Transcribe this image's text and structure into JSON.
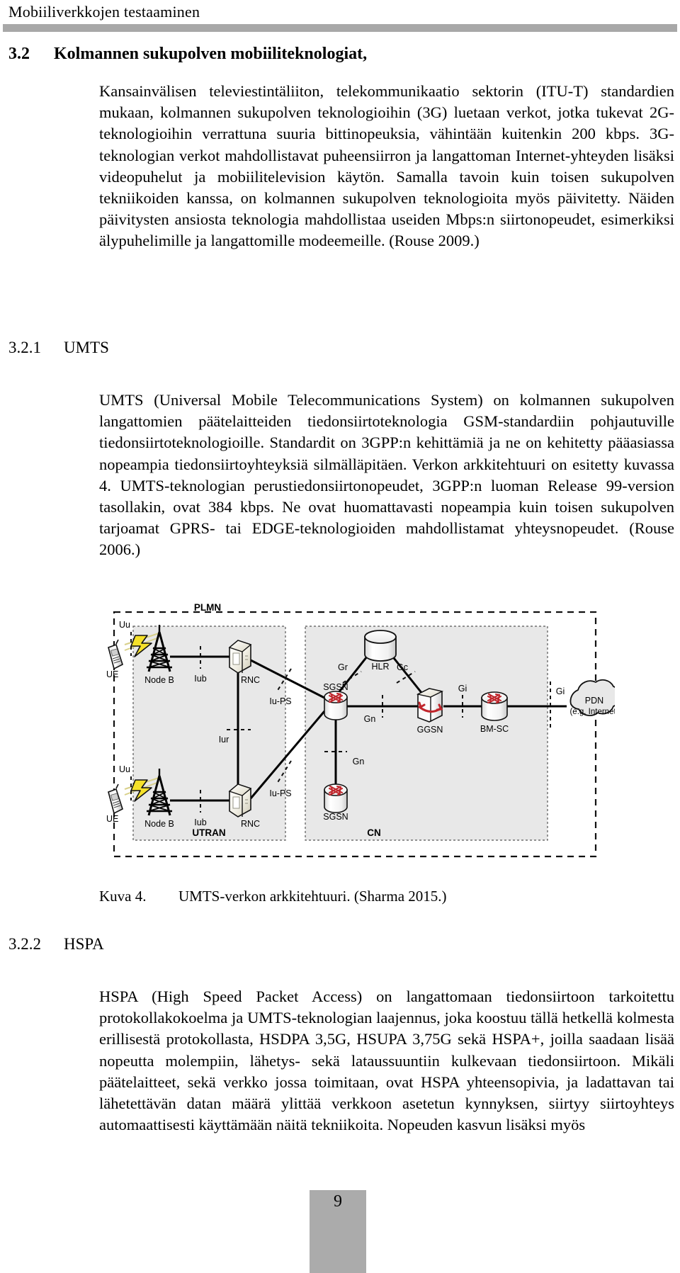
{
  "header": {
    "running_title": "Mobiiliverkkojen testaaminen"
  },
  "sections": [
    {
      "number": "3.2",
      "title": "Kolmannen sukupolven mobiiliteknologiat,",
      "body": "Kansainvälisen televiestintäliiton, telekommunikaatio sektorin (ITU-T) standardien mukaan, kolmannen sukupolven teknologioihin (3G) luetaan verkot, jotka tukevat 2G-teknologioihin verrattuna suuria bittinopeuksia, vähintään kuitenkin 200 kbps. 3G-teknologian verkot mahdollistavat puheensiirron ja langattoman Internet-yhteyden lisäksi videopuhelut ja mobiilitelevision käytön. Samalla tavoin kuin toisen sukupolven tekniikoiden kanssa, on kolmannen sukupolven teknologioita myös päivitetty. Näiden päivitysten ansiosta teknologia mahdollistaa useiden Mbps:n siirtonopeudet, esimerkiksi älypuhelimille ja langattomille modeemeille. (Rouse 2009.)"
    },
    {
      "number": "3.2.1",
      "title": "UMTS",
      "body": "UMTS (Universal Mobile Telecommunications System) on kolmannen sukupolven langattomien päätelaitteiden tiedonsiirtoteknologia GSM-standardiin pohjautuville tiedonsiirtoteknologioille. Standardit on 3GPP:n kehittämiä ja ne on kehitetty pääasiassa nopeampia tiedonsiirtoyhteyksiä silmälläpitäen. Verkon arkkitehtuuri on esitetty kuvassa 4. UMTS-teknologian perustiedonsiirtonopeudet, 3GPP:n luoman Release 99-version tasollakin, ovat 384 kbps. Ne ovat huomattavasti nopeampia kuin toisen sukupolven tarjoamat GPRS- tai EDGE-teknologioiden mahdollistamat yhteysnopeudet. (Rouse 2006.)"
    },
    {
      "number": "3.2.2",
      "title": "HSPA",
      "body": "HSPA (High Speed Packet Access) on langattomaan tiedonsiirtoon tarkoitettu protokollakokoelma ja UMTS-teknologian laajennus, joka koostuu tällä hetkellä kolmesta erillisestä protokollasta, HSDPA 3,5G, HSUPA 3,75G sekä HSPA+, joilla saadaan lisää nopeutta molempiin, lähetys- sekä lataussuuntiin kulkevaan tiedonsiirtoon. Mikäli päätelaitteet, sekä verkko jossa toimitaan, ovat HSPA yhteensopivia, ja ladattavan tai lähetettävän datan määrä ylittää verkkoon asetetun kynnyksen, siirtyy siirtoyhteys automaattisesti käyttämään näitä tekniikoita. Nopeuden kasvun lisäksi myös"
    }
  ],
  "figure": {
    "caption_number": "Kuva 4.",
    "caption_text": "UMTS-verkon arkkitehtuuri. (Sharma 2015.)",
    "diagram": {
      "zones": [
        {
          "id": "plmn",
          "label": "PLMN"
        },
        {
          "id": "utran",
          "label": "UTRAN"
        },
        {
          "id": "cn",
          "label": "CN"
        }
      ],
      "nodes": [
        {
          "id": "ue-top",
          "label": "UE",
          "type": "handset-icon"
        },
        {
          "id": "ue-bottom",
          "label": "UE",
          "type": "handset-icon"
        },
        {
          "id": "nodeb-top",
          "label": "Node B",
          "type": "antenna-tower-icon"
        },
        {
          "id": "nodeb-bottom",
          "label": "Node B",
          "type": "antenna-tower-icon"
        },
        {
          "id": "rnc-top",
          "label": "RNC",
          "type": "server-icon"
        },
        {
          "id": "rnc-bottom",
          "label": "RNC",
          "type": "server-icon"
        },
        {
          "id": "sgsn-top",
          "label": "SGSN",
          "type": "router-icon"
        },
        {
          "id": "sgsn-bottom",
          "label": "SGSN",
          "type": "router-icon"
        },
        {
          "id": "hlr",
          "label": "HLR",
          "type": "database-icon"
        },
        {
          "id": "ggsn",
          "label": "GGSN",
          "type": "gateway-icon"
        },
        {
          "id": "bmsc",
          "label": "BM-SC",
          "type": "router-icon"
        },
        {
          "id": "pdn",
          "label": "PDN",
          "sublabel": "(e.g. Internet)",
          "type": "cloud-icon"
        }
      ],
      "interfaces": [
        {
          "id": "uu-top",
          "label": "Uu"
        },
        {
          "id": "uu-bottom",
          "label": "Uu"
        },
        {
          "id": "iub-top",
          "label": "Iub"
        },
        {
          "id": "iub-bottom",
          "label": "Iub"
        },
        {
          "id": "iur",
          "label": "Iur"
        },
        {
          "id": "iups-top",
          "label": "Iu-PS"
        },
        {
          "id": "iups-bottom",
          "label": "Iu-PS"
        },
        {
          "id": "gr",
          "label": "Gr"
        },
        {
          "id": "gc",
          "label": "Gc"
        },
        {
          "id": "gn-top",
          "label": "Gn"
        },
        {
          "id": "gn-bottom",
          "label": "Gn"
        },
        {
          "id": "gi-left",
          "label": "Gi"
        },
        {
          "id": "gi-right",
          "label": "Gi"
        }
      ],
      "colors": {
        "zone_fill": "#e8e8e8",
        "accent_red": "#c0262c",
        "lightning_yellow": "#f5e12a",
        "rule_gray": "#a8a8a8"
      }
    }
  },
  "footer": {
    "page_number": "9"
  }
}
